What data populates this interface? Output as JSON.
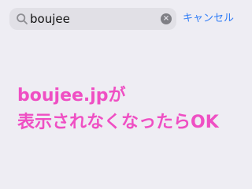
{
  "search": {
    "value": "boujee",
    "placeholder": "",
    "search_icon": "search-icon",
    "clear_icon": "clear-icon",
    "clear_glyph": "×",
    "cancel_label": "キャンセル"
  },
  "message": {
    "line1": "boujee.jpが",
    "line2": "表示されなくなったらOK"
  },
  "colors": {
    "background": "#eeedf3",
    "search_field": "#e1e0e6",
    "accent": "#2f7cf7",
    "message": "#ef4fc3"
  }
}
